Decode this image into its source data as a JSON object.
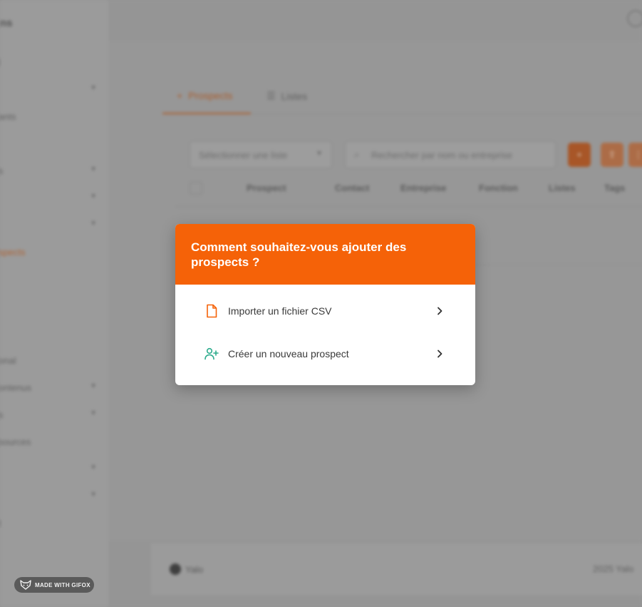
{
  "background": {
    "sidebar": {
      "brand": "ns",
      "items": [
        {
          "label": "l",
          "chevron": false
        },
        {
          "label": "",
          "chevron": true
        },
        {
          "label": "ants",
          "chevron": false
        },
        {
          "label": "s",
          "chevron": true
        },
        {
          "label": "",
          "chevron": true
        },
        {
          "label": "",
          "chevron": true
        },
        {
          "label": "spects",
          "chevron": false,
          "active": true
        },
        {
          "label": "onal",
          "chevron": false
        },
        {
          "label": "ontenus",
          "chevron": true
        },
        {
          "label": "s",
          "chevron": true
        },
        {
          "label": "sources",
          "chevron": false
        },
        {
          "label": "",
          "chevron": true
        },
        {
          "label": "",
          "chevron": true
        },
        {
          "label": "t",
          "chevron": false
        }
      ]
    },
    "tabs": [
      {
        "label": "Prospects",
        "icon": "plus-icon",
        "active": true
      },
      {
        "label": "Listes",
        "icon": "list-icon",
        "active": false
      }
    ],
    "toolbar": {
      "select_placeholder": "Sélectionner une liste",
      "search_placeholder": "Rechercher par nom ou entreprise"
    },
    "table_headers": [
      "Prospect",
      "Contact",
      "Entreprise",
      "Fonction",
      "Listes",
      "Tags"
    ],
    "footer": {
      "logo_text": "Yalo",
      "copyright": "2025 Yalo"
    }
  },
  "modal": {
    "title": "Comment souhaitez-vous ajouter des prospects ?",
    "header_color": "#f56208",
    "options": [
      {
        "label": "Importer un fichier CSV",
        "icon": "file-icon",
        "icon_color": "#f56208"
      },
      {
        "label": "Créer un nouveau prospect",
        "icon": "user-plus-icon",
        "icon_color": "#2bab8c"
      }
    ]
  },
  "badge": {
    "text": "MADE WITH GIFOX"
  }
}
